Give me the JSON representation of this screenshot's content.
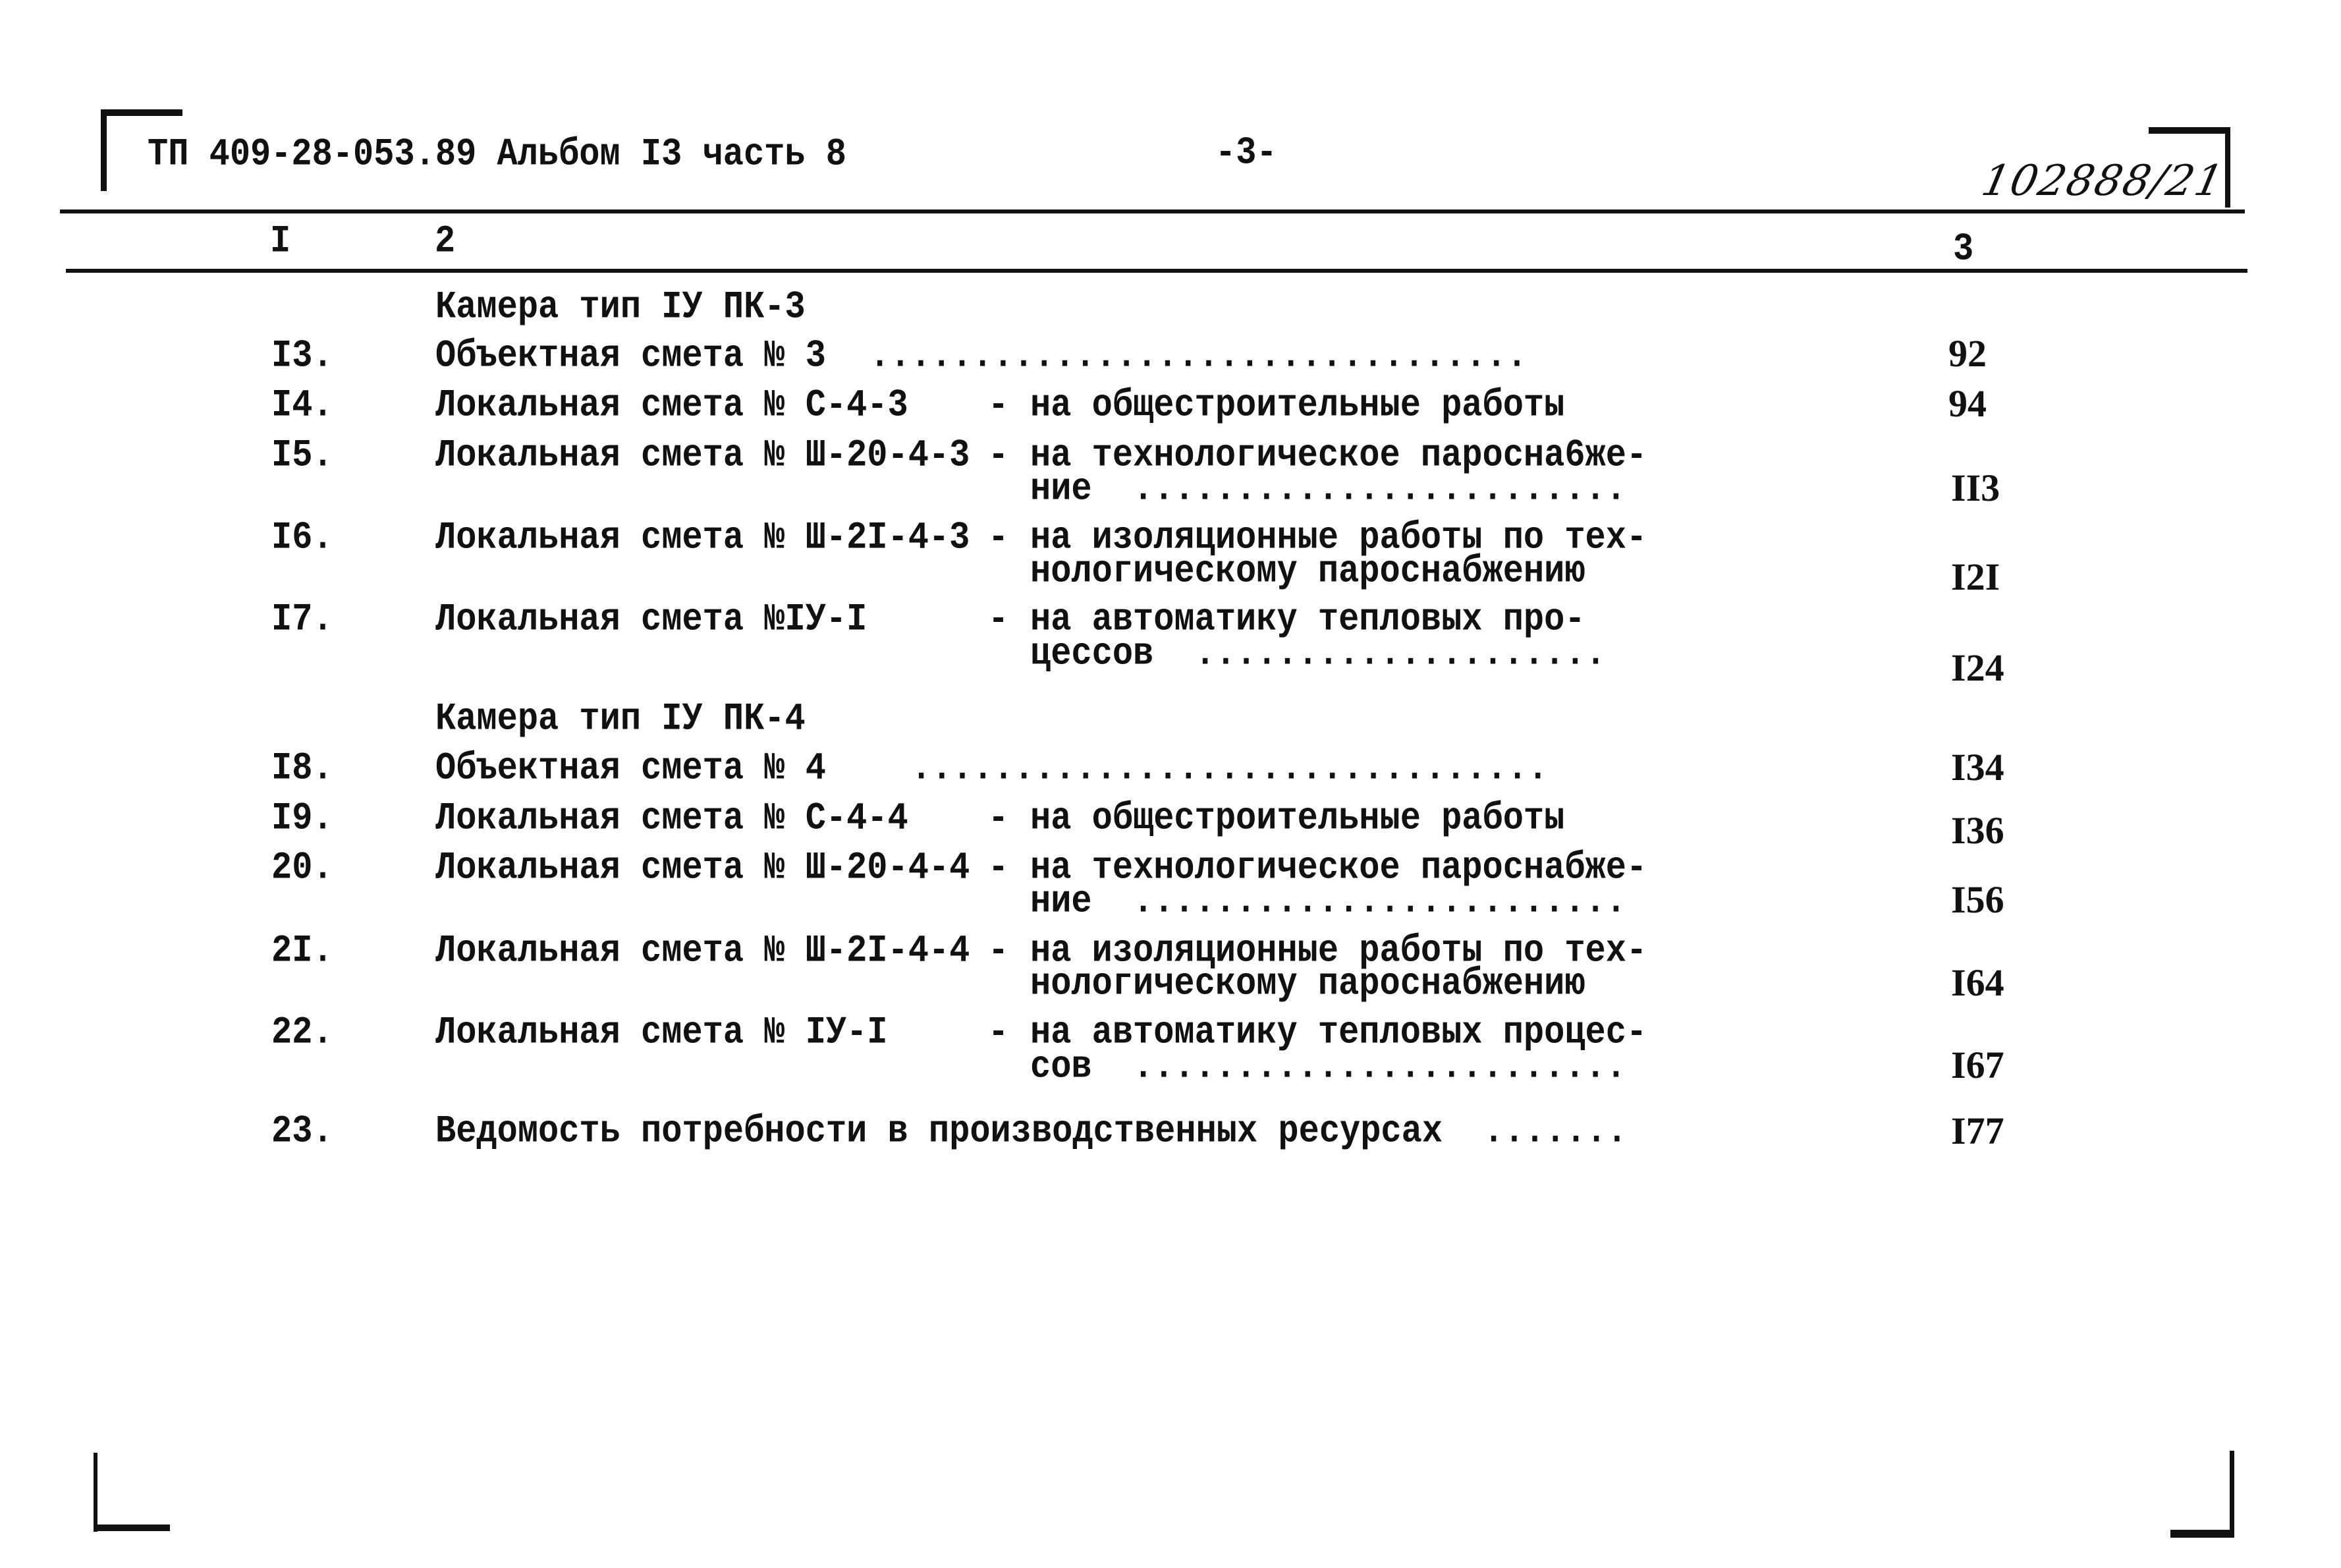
{
  "header": {
    "doc_code": "ТП 409-28-053.89 Альбом I3 часть 8",
    "page_marker": "-3-",
    "handwritten_number": "102888/21"
  },
  "columns": {
    "col1": "I",
    "col2": "2",
    "col3": "3"
  },
  "sections": [
    {
      "title": "Камера тип IУ ПК-3"
    },
    {
      "title": "Камера тип IУ ПК-4"
    }
  ],
  "rows": [
    {
      "num": "I3.",
      "name": "Объектная смета № 3",
      "dash": "",
      "desc1": "",
      "desc2": "",
      "dots": "................................",
      "page": "92"
    },
    {
      "num": "I4.",
      "name": "Локальная смета № С-4-3",
      "dash": "-",
      "desc1": "на общестроительные работы",
      "desc2": "",
      "dots": "",
      "page": "94"
    },
    {
      "num": "I5.",
      "name": "Локальная смета № Ш-20-4-3",
      "dash": "-",
      "desc1": "на технологическое паросна6же-",
      "desc2": "ние",
      "dots": "........................",
      "page": "II3"
    },
    {
      "num": "I6.",
      "name": "Локальная смета № Ш-2I-4-3",
      "dash": "-",
      "desc1": "на изоляционные работы по тех-",
      "desc2": "нологическому пароснабжению",
      "dots": "",
      "page": "I2I"
    },
    {
      "num": "I7.",
      "name": "Локальная смета №IУ-I",
      "dash": "-",
      "desc1": "на автоматику тепловых про-",
      "desc2": "цессов",
      "dots": "....................",
      "page": "I24"
    },
    {
      "num": "I8.",
      "name": "Объектная смета № 4",
      "dash": "",
      "desc1": "",
      "desc2": "",
      "dots": "...............................",
      "page": "I34"
    },
    {
      "num": "I9.",
      "name": "Локальная смета № С-4-4",
      "dash": "-",
      "desc1": "на общестроительные работы",
      "desc2": "",
      "dots": "",
      "page": "I36"
    },
    {
      "num": "20.",
      "name": "Локальная смета № Ш-20-4-4",
      "dash": "-",
      "desc1": "на технологическое пароснабже-",
      "desc2": "ние",
      "dots": "........................",
      "page": "I56"
    },
    {
      "num": "2I.",
      "name": "Локальная смета № Ш-2I-4-4",
      "dash": "-",
      "desc1": "на изоляционные работы по тех-",
      "desc2": "нологическому пароснабжению",
      "dots": "",
      "page": "I64"
    },
    {
      "num": "22.",
      "name": "Локальная смета № IУ-I",
      "dash": "-",
      "desc1": "на автоматику тепловых процес-",
      "desc2": "сов",
      "dots": "........................",
      "page": "I67"
    },
    {
      "num": "23.",
      "name": "Ведомость потребности в производственных ресурсах",
      "dash": "",
      "desc1": "",
      "desc2": "",
      "dots": ".......",
      "page": "I77"
    }
  ]
}
